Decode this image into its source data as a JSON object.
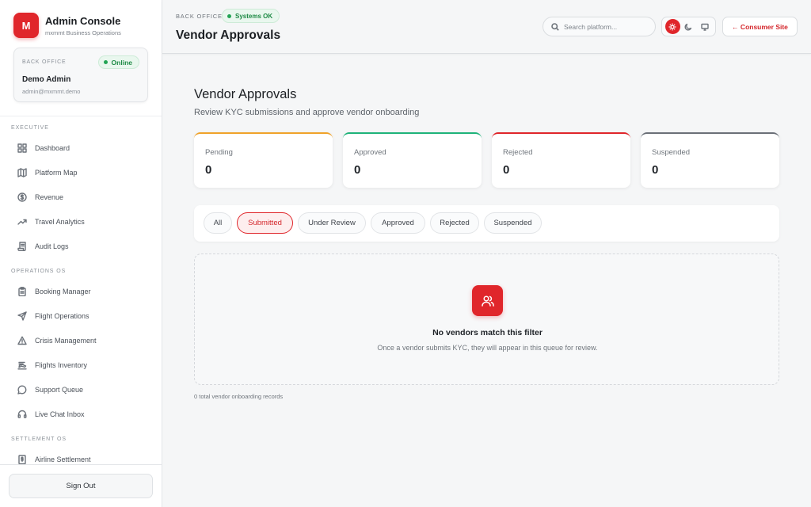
{
  "sidebar": {
    "brand": {
      "logo": "M",
      "title": "Admin Console",
      "subtitle": "mxmmt Business Operations"
    },
    "user_card": {
      "label": "BACK OFFICE",
      "status": "Online",
      "name": "Demo Admin",
      "email": "admin@mxmmt.demo"
    },
    "sections": [
      {
        "title": "EXECUTIVE",
        "items": [
          {
            "label": "Dashboard",
            "icon": "grid-icon"
          },
          {
            "label": "Platform Map",
            "icon": "map-icon"
          },
          {
            "label": "Revenue",
            "icon": "dollar-icon"
          },
          {
            "label": "Travel Analytics",
            "icon": "trend-icon"
          },
          {
            "label": "Audit Logs",
            "icon": "scroll-icon"
          }
        ]
      },
      {
        "title": "OPERATIONS OS",
        "items": [
          {
            "label": "Booking Manager",
            "icon": "clipboard-icon"
          },
          {
            "label": "Flight Operations",
            "icon": "plane-icon"
          },
          {
            "label": "Crisis Management",
            "icon": "alert-triangle-icon"
          },
          {
            "label": "Flights Inventory",
            "icon": "inventory-icon"
          },
          {
            "label": "Support Queue",
            "icon": "message-icon"
          },
          {
            "label": "Live Chat Inbox",
            "icon": "headset-icon"
          }
        ]
      },
      {
        "title": "SETTLEMENT OS",
        "items": [
          {
            "label": "Airline Settlement",
            "icon": "receipt-icon"
          }
        ]
      }
    ],
    "sign_out": "Sign Out"
  },
  "header": {
    "label": "BACK OFFICE",
    "status": "Systems OK",
    "title": "Vendor Approvals",
    "search_placeholder": "Search platform...",
    "theme_active": "light",
    "consumer_site": "← Consumer Site"
  },
  "main": {
    "title": "Vendor Approvals",
    "subtitle": "Review KYC submissions and approve vendor onboarding",
    "stats": [
      {
        "label": "Pending",
        "value": "0",
        "color": "#f0a32a"
      },
      {
        "label": "Approved",
        "value": "0",
        "color": "#1fb37a"
      },
      {
        "label": "Rejected",
        "value": "0",
        "color": "#e0262b"
      },
      {
        "label": "Suspended",
        "value": "0",
        "color": "#6b7078"
      }
    ],
    "filters": [
      "All",
      "Submitted",
      "Under Review",
      "Approved",
      "Rejected",
      "Suspended"
    ],
    "active_filter": "Submitted",
    "empty": {
      "title": "No vendors match this filter",
      "description": "Once a vendor submits KYC, they will appear in this queue for review."
    },
    "records": "0 total vendor onboarding records"
  },
  "colors": {
    "accent": "#e0262b",
    "success": "#22a454"
  }
}
